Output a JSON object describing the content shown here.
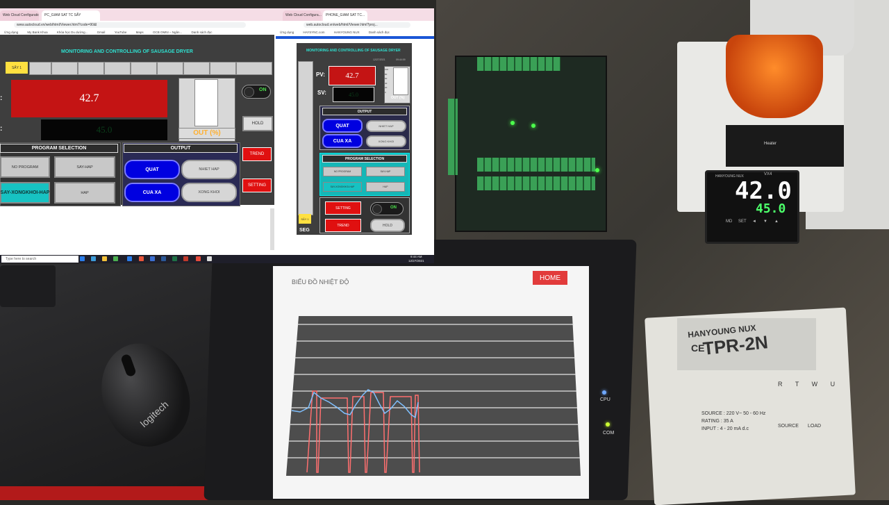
{
  "browser_left": {
    "tab1": "Web Cloud Configuration",
    "tab2": "PC_GIAM SAT TC SẤY",
    "address": "www.autocloud.vn/web/html/Viewer.html?code=90&l",
    "bookmarks": [
      "Ứng dụng",
      "My Bank Khoa",
      "Khóa học Du dường...",
      "Gmail",
      "YouTube",
      "Maps",
      "OCB OMNI – Ngân...",
      "Danh sách đọc"
    ]
  },
  "browser_right": {
    "tab1": "Web Cloud Configura...",
    "tab2": "PHONE_GIAM SAT TC...",
    "address": "web.autocloud.vn/web/html/Viewer.html?proj...",
    "bookmarks": [
      "Ứng dụng",
      "HAYSYNC.com",
      "HANYOUNG NUX",
      "Danh sách đọc"
    ]
  },
  "scada": {
    "title": "MONITORING AND CONTROLLING OF SAUSAGE DRYER",
    "title_short": "MONITORING AND CONTROLLING OF SAUSAGE DRYER",
    "say_chip": "SẤY 1",
    "pv_label": "PV:",
    "sv_label": "SV:",
    "pv_value": "42.7",
    "sv_value": "45.0",
    "out_label": "OUT (%)",
    "toggle_label": "ON",
    "hold_label": "HOLD",
    "trend_label": "TREND",
    "setting_label": "SETTING",
    "program_header": "PROGRAM SELECTION",
    "output_header": "OUTPUT",
    "program_buttons": [
      "NO PROGRAM",
      "SAY-HAP",
      "SAY-XONGKHOI-HAP",
      "HAP"
    ],
    "output_buttons": [
      "QUAT",
      "NHIET HAP",
      "CUA XA",
      "XONG KHOI"
    ],
    "seg_label": "SEG",
    "tank_ticks": [
      "100",
      "80",
      "60",
      "40",
      "20",
      "0"
    ],
    "date_text": "12/27/2021",
    "time_text": "09:44:09"
  },
  "taskbar": {
    "search_placeholder": "Type here to search",
    "clock_time": "9:44 AM",
    "clock_date": "12/27/2021"
  },
  "hmi": {
    "title": "BIỂU ĐỒ NHIỆT ĐỘ",
    "home_label": "HOME",
    "cpu_label": "CPU",
    "com_label": "COM"
  },
  "controller": {
    "brand": "HANYOUNG NUX",
    "model": "VX4",
    "pv": "42.0",
    "sv": "45.0",
    "buttons": [
      "MD",
      "SET",
      "◄",
      "▼",
      "▲"
    ]
  },
  "relay_label": "Heater",
  "power_regulator": {
    "brand": "HANYOUNG NUX",
    "model": "TPR-2N",
    "ce": "CE",
    "source": "SOURCE : 220 V~ 50 - 60 Hz",
    "rating": "RATING : 35 A",
    "input": "INPUT : 4 - 20 mA d.c",
    "terminals": "R T W U",
    "bottom_labels": [
      "SOURCE",
      "LOAD"
    ]
  }
}
